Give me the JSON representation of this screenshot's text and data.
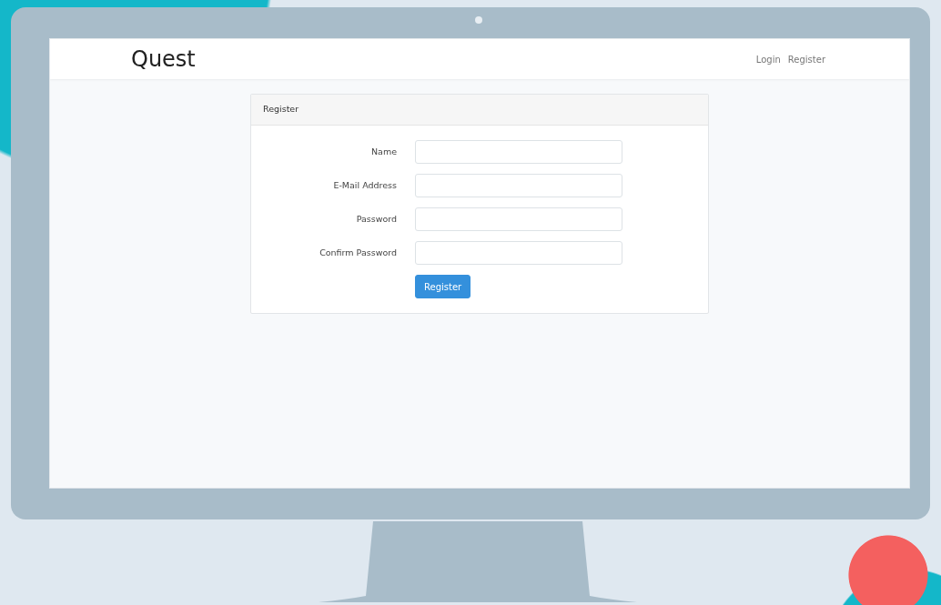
{
  "navbar": {
    "brand": "Quest",
    "links": [
      {
        "label": "Login"
      },
      {
        "label": "Register"
      }
    ]
  },
  "card": {
    "header": "Register",
    "fields": [
      {
        "label": "Name"
      },
      {
        "label": "E-Mail Address"
      },
      {
        "label": "Password"
      },
      {
        "label": "Confirm Password"
      }
    ],
    "submit": "Register"
  }
}
